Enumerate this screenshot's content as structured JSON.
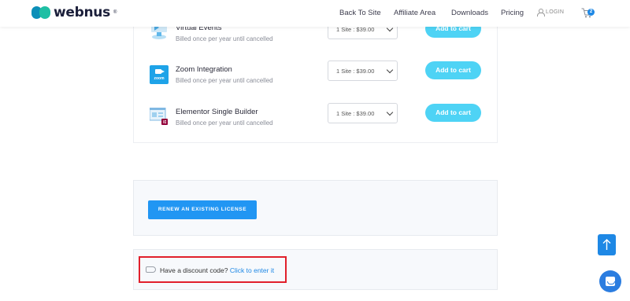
{
  "header": {
    "brand": "webnus",
    "brand_mark": "®",
    "nav": {
      "back": "Back To Site",
      "affiliate": "Affiliate Area",
      "downloads": "Downloads",
      "pricing": "Pricing"
    },
    "login_label": "LOGIN",
    "cart_count": "2"
  },
  "products": [
    {
      "name": "Virtual Events",
      "billing": "Billed once per year until cancelled",
      "plan": "1 Site : $39.00",
      "cta": "Add to cart",
      "icon": "virtual-events-icon"
    },
    {
      "name": "Zoom Integration",
      "billing": "Billed once per year until cancelled",
      "plan": "1 Site : $39.00",
      "cta": "Add to cart",
      "icon": "zoom-icon",
      "icon_text": "zoom"
    },
    {
      "name": "Elementor Single Builder",
      "billing": "Billed once per year until cancelled",
      "plan": "1 Site : $39.00",
      "cta": "Add to cart",
      "icon": "elementor-builder-icon"
    }
  ],
  "renew": {
    "label": "RENEW AN EXISTING LICENSE"
  },
  "discount": {
    "prompt": "Have a discount code?",
    "link": "Click to enter it"
  },
  "colors": {
    "accent": "#2196f3",
    "add_to_cart": "#4ed3f5",
    "highlight": "#e11f2b",
    "link": "#1e88e5"
  }
}
